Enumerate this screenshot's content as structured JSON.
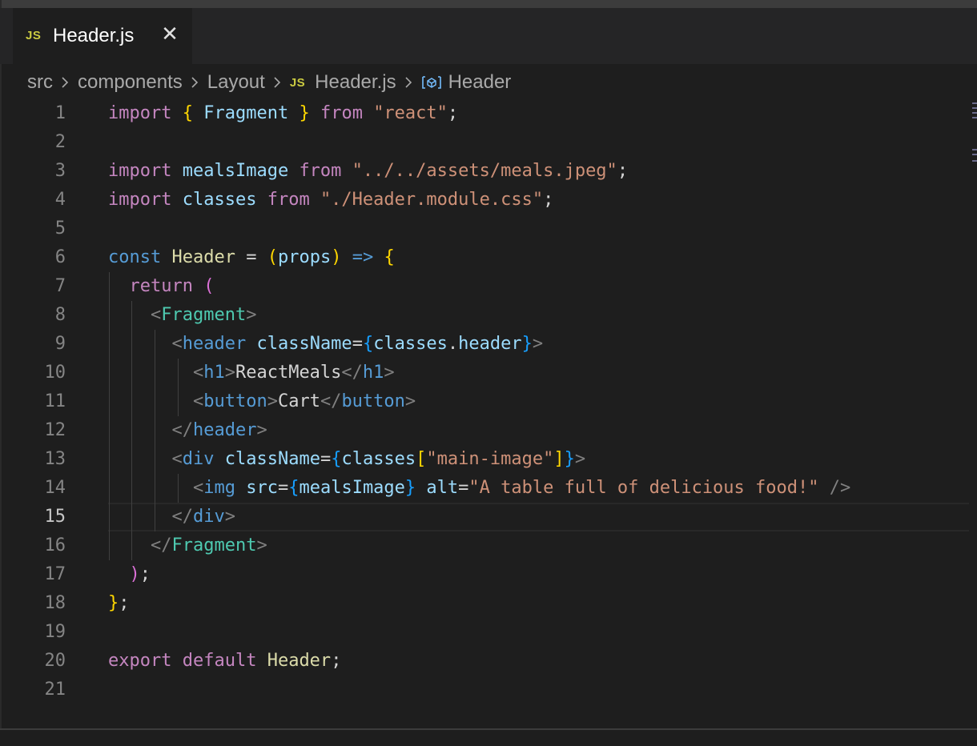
{
  "tab": {
    "badge": "JS",
    "label": "Header.js",
    "close_glyph": "✕"
  },
  "breadcrumb": {
    "items": [
      "src",
      "components",
      "Layout"
    ],
    "file_badge": "JS",
    "file": "Header.js",
    "symbol_icon": "symbol-variable-icon",
    "symbol": "Header"
  },
  "active_line": 15,
  "code": [
    [
      [
        "k",
        "import"
      ],
      [
        "w",
        " "
      ],
      [
        "b1",
        "{"
      ],
      [
        "w",
        " "
      ],
      [
        "v",
        "Fragment"
      ],
      [
        "w",
        " "
      ],
      [
        "b1",
        "}"
      ],
      [
        "w",
        " "
      ],
      [
        "k",
        "from"
      ],
      [
        "w",
        " "
      ],
      [
        "s",
        "\"react\""
      ],
      [
        "w",
        ";"
      ]
    ],
    [],
    [
      [
        "k",
        "import"
      ],
      [
        "w",
        " "
      ],
      [
        "v",
        "mealsImage"
      ],
      [
        "w",
        " "
      ],
      [
        "k",
        "from"
      ],
      [
        "w",
        " "
      ],
      [
        "s",
        "\"../../assets/meals.jpeg\""
      ],
      [
        "w",
        ";"
      ]
    ],
    [
      [
        "k",
        "import"
      ],
      [
        "w",
        " "
      ],
      [
        "v",
        "classes"
      ],
      [
        "w",
        " "
      ],
      [
        "k",
        "from"
      ],
      [
        "w",
        " "
      ],
      [
        "s",
        "\"./Header.module.css\""
      ],
      [
        "w",
        ";"
      ]
    ],
    [],
    [
      [
        "d",
        "const"
      ],
      [
        "w",
        " "
      ],
      [
        "f",
        "Header"
      ],
      [
        "w",
        " = "
      ],
      [
        "b1",
        "("
      ],
      [
        "v",
        "props"
      ],
      [
        "b1",
        ")"
      ],
      [
        "w",
        " "
      ],
      [
        "d",
        "=>"
      ],
      [
        "w",
        " "
      ],
      [
        "b1",
        "{"
      ]
    ],
    [
      [
        "w",
        "  "
      ],
      [
        "k",
        "return"
      ],
      [
        "w",
        " "
      ],
      [
        "b2",
        "("
      ]
    ],
    [
      [
        "w",
        "    "
      ],
      [
        "p",
        "<"
      ],
      [
        "t",
        "Fragment"
      ],
      [
        "p",
        ">"
      ]
    ],
    [
      [
        "w",
        "      "
      ],
      [
        "p",
        "<"
      ],
      [
        "d",
        "header"
      ],
      [
        "w",
        " "
      ],
      [
        "a",
        "className"
      ],
      [
        "w",
        "="
      ],
      [
        "b3",
        "{"
      ],
      [
        "v",
        "classes"
      ],
      [
        "w",
        "."
      ],
      [
        "v",
        "header"
      ],
      [
        "b3",
        "}"
      ],
      [
        "p",
        ">"
      ]
    ],
    [
      [
        "w",
        "        "
      ],
      [
        "p",
        "<"
      ],
      [
        "d",
        "h1"
      ],
      [
        "p",
        ">"
      ],
      [
        "w",
        "ReactMeals"
      ],
      [
        "p",
        "</"
      ],
      [
        "d",
        "h1"
      ],
      [
        "p",
        ">"
      ]
    ],
    [
      [
        "w",
        "        "
      ],
      [
        "p",
        "<"
      ],
      [
        "d",
        "button"
      ],
      [
        "p",
        ">"
      ],
      [
        "w",
        "Cart"
      ],
      [
        "p",
        "</"
      ],
      [
        "d",
        "button"
      ],
      [
        "p",
        ">"
      ]
    ],
    [
      [
        "w",
        "      "
      ],
      [
        "p",
        "</"
      ],
      [
        "d",
        "header"
      ],
      [
        "p",
        ">"
      ]
    ],
    [
      [
        "w",
        "      "
      ],
      [
        "p",
        "<"
      ],
      [
        "d",
        "div"
      ],
      [
        "w",
        " "
      ],
      [
        "a",
        "className"
      ],
      [
        "w",
        "="
      ],
      [
        "b3",
        "{"
      ],
      [
        "v",
        "classes"
      ],
      [
        "b1",
        "["
      ],
      [
        "s",
        "\"main-image\""
      ],
      [
        "b1",
        "]"
      ],
      [
        "b3",
        "}"
      ],
      [
        "p",
        ">"
      ]
    ],
    [
      [
        "w",
        "        "
      ],
      [
        "p",
        "<"
      ],
      [
        "d",
        "img"
      ],
      [
        "w",
        " "
      ],
      [
        "a",
        "src"
      ],
      [
        "w",
        "="
      ],
      [
        "b3",
        "{"
      ],
      [
        "v",
        "mealsImage"
      ],
      [
        "b3",
        "}"
      ],
      [
        "w",
        " "
      ],
      [
        "a",
        "alt"
      ],
      [
        "w",
        "="
      ],
      [
        "s",
        "\"A table full of delicious food!\""
      ],
      [
        "w",
        " "
      ],
      [
        "p",
        "/>"
      ]
    ],
    [
      [
        "w",
        "      "
      ],
      [
        "p",
        "</"
      ],
      [
        "d",
        "div"
      ],
      [
        "p",
        ">"
      ]
    ],
    [
      [
        "w",
        "    "
      ],
      [
        "p",
        "</"
      ],
      [
        "t",
        "Fragment"
      ],
      [
        "p",
        ">"
      ]
    ],
    [
      [
        "w",
        "  "
      ],
      [
        "b2",
        ")"
      ],
      [
        "w",
        ";"
      ]
    ],
    [
      [
        "b1",
        "}"
      ],
      [
        "w",
        ";"
      ]
    ],
    [],
    [
      [
        "k",
        "export"
      ],
      [
        "w",
        " "
      ],
      [
        "k",
        "default"
      ],
      [
        "w",
        " "
      ],
      [
        "f",
        "Header"
      ],
      [
        "w",
        ";"
      ]
    ],
    []
  ]
}
